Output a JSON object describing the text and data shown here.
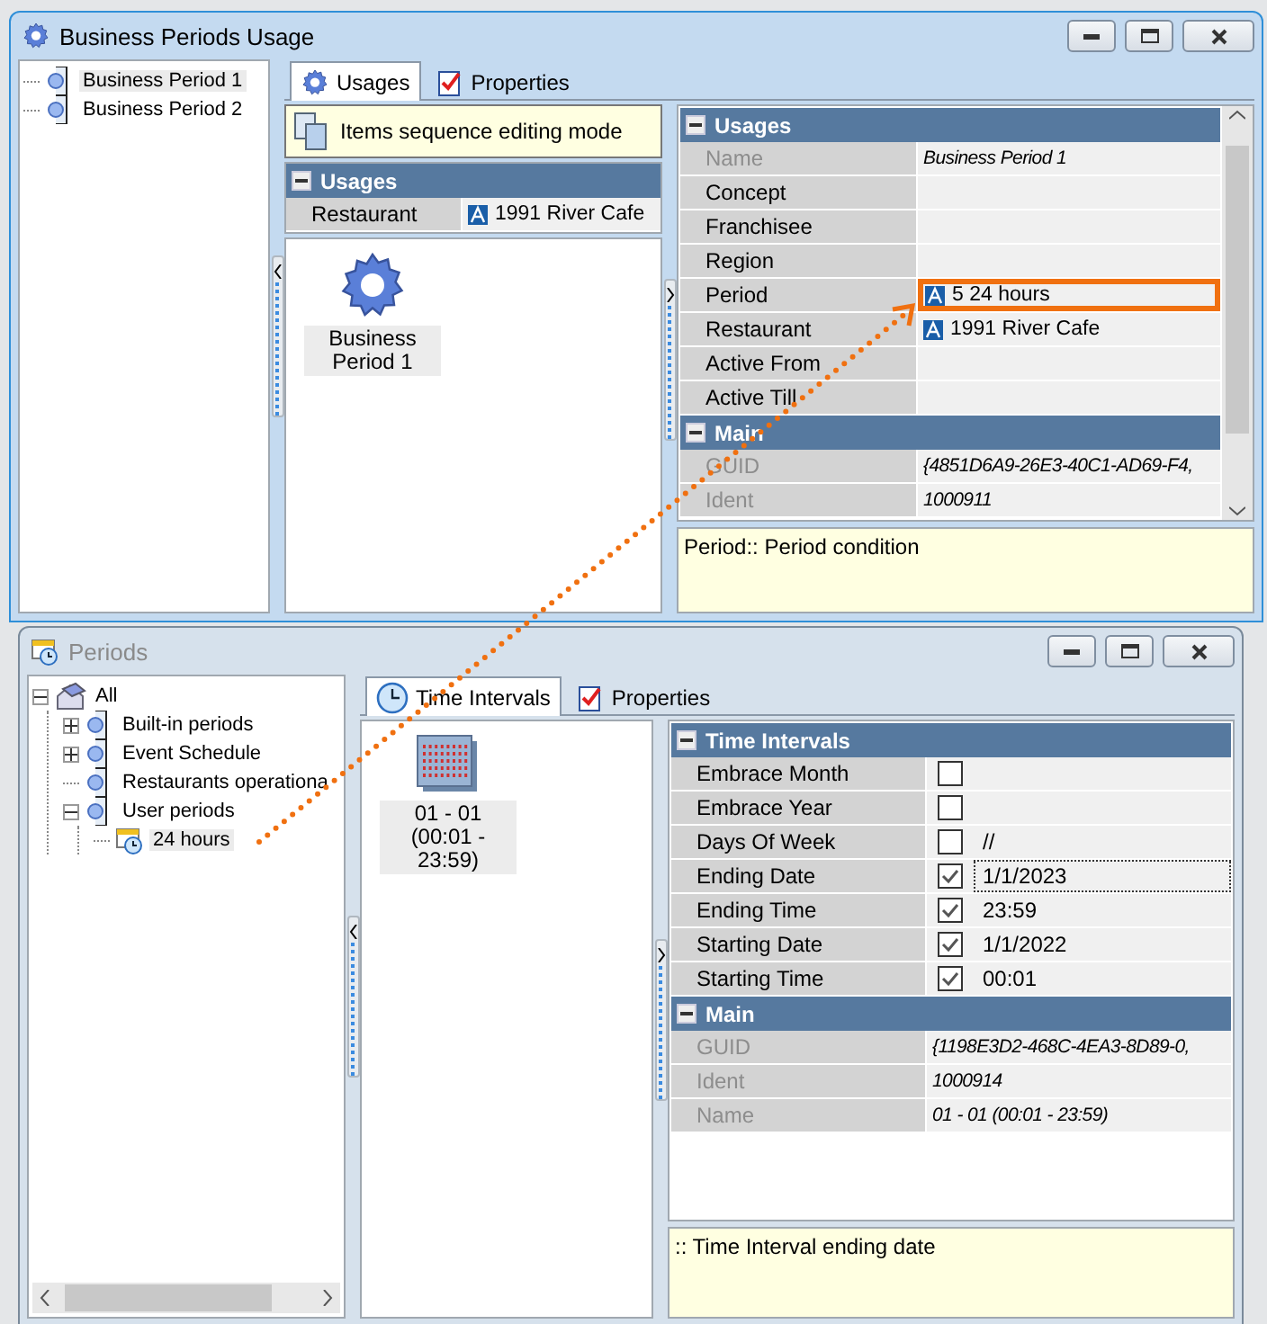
{
  "windows": [
    {
      "title": "Business Periods Usage",
      "active": true,
      "tree": [
        {
          "label": "Business Period 1",
          "kind": "group",
          "selected": true
        },
        {
          "label": "Business Period 2",
          "kind": "group",
          "selected": false
        }
      ],
      "tabs": [
        {
          "label": "Usages",
          "selected": true
        },
        {
          "label": "Properties",
          "selected": false
        }
      ],
      "banner": "Items sequence editing mode",
      "usages": {
        "title": "Usages",
        "expanded": true,
        "rows": [
          {
            "label": "Restaurant",
            "value": "1991 River Cafe"
          }
        ]
      },
      "items": [
        {
          "label": "Business Period 1",
          "kind": "gear",
          "selected": true
        }
      ],
      "sections": [
        {
          "title": "Usages",
          "expanded": true,
          "rows": [
            {
              "kind": "text",
              "label": "Name",
              "value": "Business Period 1",
              "readonly": true,
              "ref": false,
              "highlighted": false
            },
            {
              "kind": "text",
              "label": "Concept",
              "readonly": false,
              "ref": false,
              "highlighted": false
            },
            {
              "kind": "text",
              "label": "Franchisee",
              "readonly": false,
              "ref": false,
              "highlighted": false
            },
            {
              "kind": "text",
              "label": "Region",
              "readonly": false,
              "ref": false,
              "highlighted": false
            },
            {
              "kind": "text",
              "label": "Period",
              "value": "5 24 hours",
              "readonly": false,
              "ref": true,
              "highlighted": true
            },
            {
              "kind": "text",
              "label": "Restaurant",
              "value": "1991 River Cafe",
              "readonly": false,
              "ref": true,
              "highlighted": false
            },
            {
              "kind": "text",
              "label": "Active From",
              "readonly": false,
              "ref": false,
              "highlighted": false
            },
            {
              "kind": "text",
              "label": "Active Till",
              "readonly": false,
              "ref": false,
              "highlighted": false
            }
          ]
        },
        {
          "title": "Main",
          "expanded": true,
          "rows": [
            {
              "kind": "text",
              "label": "GUID",
              "value": "{4851D6A9-26E3-40C1-AD69-F4,",
              "readonly": true,
              "ref": false,
              "highlighted": false
            },
            {
              "kind": "text",
              "label": "Ident",
              "value": "1000911",
              "readonly": true,
              "ref": false,
              "highlighted": false
            }
          ]
        }
      ],
      "description": "Period:: Period condition"
    },
    {
      "title": "Periods",
      "active": false,
      "tree": [
        {
          "label": "All",
          "kind": "root",
          "selected": false,
          "expanded": true,
          "children": [
            {
              "label": "Built-in periods",
              "kind": "group",
              "selected": false,
              "expanded": false
            },
            {
              "label": "Event Schedule",
              "kind": "group",
              "selected": false,
              "expanded": false
            },
            {
              "label": "Restaurants operationa",
              "kind": "group",
              "selected": false
            },
            {
              "label": "User periods",
              "kind": "group",
              "selected": false,
              "expanded": true,
              "children": [
                {
                  "label": "24 hours",
                  "kind": "entry",
                  "selected": true
                }
              ]
            }
          ]
        }
      ],
      "tabs": [
        {
          "label": "Time Intervals",
          "selected": true
        },
        {
          "label": "Properties",
          "selected": false
        }
      ],
      "items": [
        {
          "label": "01 - 01 (00:01 - 23:59)",
          "kind": "grid",
          "selected": true
        }
      ],
      "sections": [
        {
          "title": "Time Intervals",
          "expanded": true,
          "rows": [
            {
              "kind": "check",
              "label": "Embrace Month",
              "checked": false
            },
            {
              "kind": "check",
              "label": "Embrace Year",
              "checked": false
            },
            {
              "kind": "check",
              "label": "Days Of Week",
              "value": "//",
              "checked": false,
              "focused": false
            },
            {
              "kind": "check",
              "label": "Ending Date",
              "value": "1/1/2023",
              "checked": true,
              "focused": true
            },
            {
              "kind": "check",
              "label": "Ending Time",
              "value": "23:59",
              "checked": true,
              "focused": false
            },
            {
              "kind": "check",
              "label": "Starting Date",
              "value": "1/1/2022",
              "checked": true,
              "focused": false
            },
            {
              "kind": "check",
              "label": "Starting Time",
              "value": "00:01",
              "checked": true,
              "focused": false
            }
          ]
        },
        {
          "title": "Main",
          "expanded": true,
          "rows": [
            {
              "kind": "text",
              "label": "GUID",
              "value": "{1198E3D2-468C-4EA3-8D89-0,",
              "readonly": true
            },
            {
              "kind": "text",
              "label": "Ident",
              "value": "1000914",
              "readonly": true
            },
            {
              "kind": "text",
              "label": "Name",
              "value": "01 - 01 (00:01 - 23:59)",
              "readonly": true
            }
          ]
        }
      ],
      "description": ":: Time Interval ending date"
    }
  ]
}
